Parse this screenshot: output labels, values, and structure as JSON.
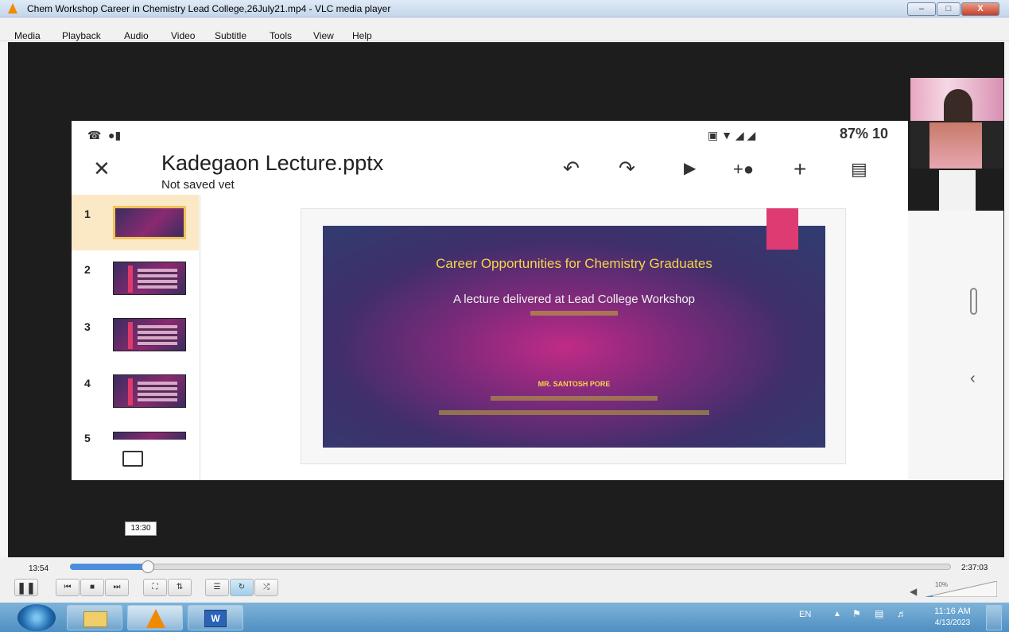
{
  "window": {
    "title": "Chem Workshop Career in Chemistry Lead College,26July21.mp4 - VLC media player",
    "controls": [
      "–",
      "□",
      "X"
    ]
  },
  "menu": [
    "Media",
    "Playback",
    "Audio",
    "Video",
    "Subtitle",
    "Tools",
    "View",
    "Help"
  ],
  "phone": {
    "status_right": "87% 10",
    "doc_title": "Kadegaon Lecture.pptx",
    "doc_status": "Not saved vet",
    "thumbs": [
      "1",
      "2",
      "3",
      "4",
      "5"
    ]
  },
  "slide": {
    "title": "Career Opportunities for Chemistry Graduates",
    "subtitle": "A lecture delivered at Lead College Workshop",
    "author": "MR. SANTOSH PORE"
  },
  "player": {
    "hover_time": "13:30",
    "current_time": "13:54",
    "total_time": "2:37:03",
    "progress": 0.088,
    "volume": "10%"
  },
  "taskbar": {
    "lang": "EN",
    "time": "11:16 AM",
    "date": "4/13/2023"
  },
  "colors": {
    "slide_title": "#f4d64a",
    "seek_fill": "#4c8edb",
    "taskbar": "#5a97c8",
    "vlc_orange": "#f08a00"
  }
}
